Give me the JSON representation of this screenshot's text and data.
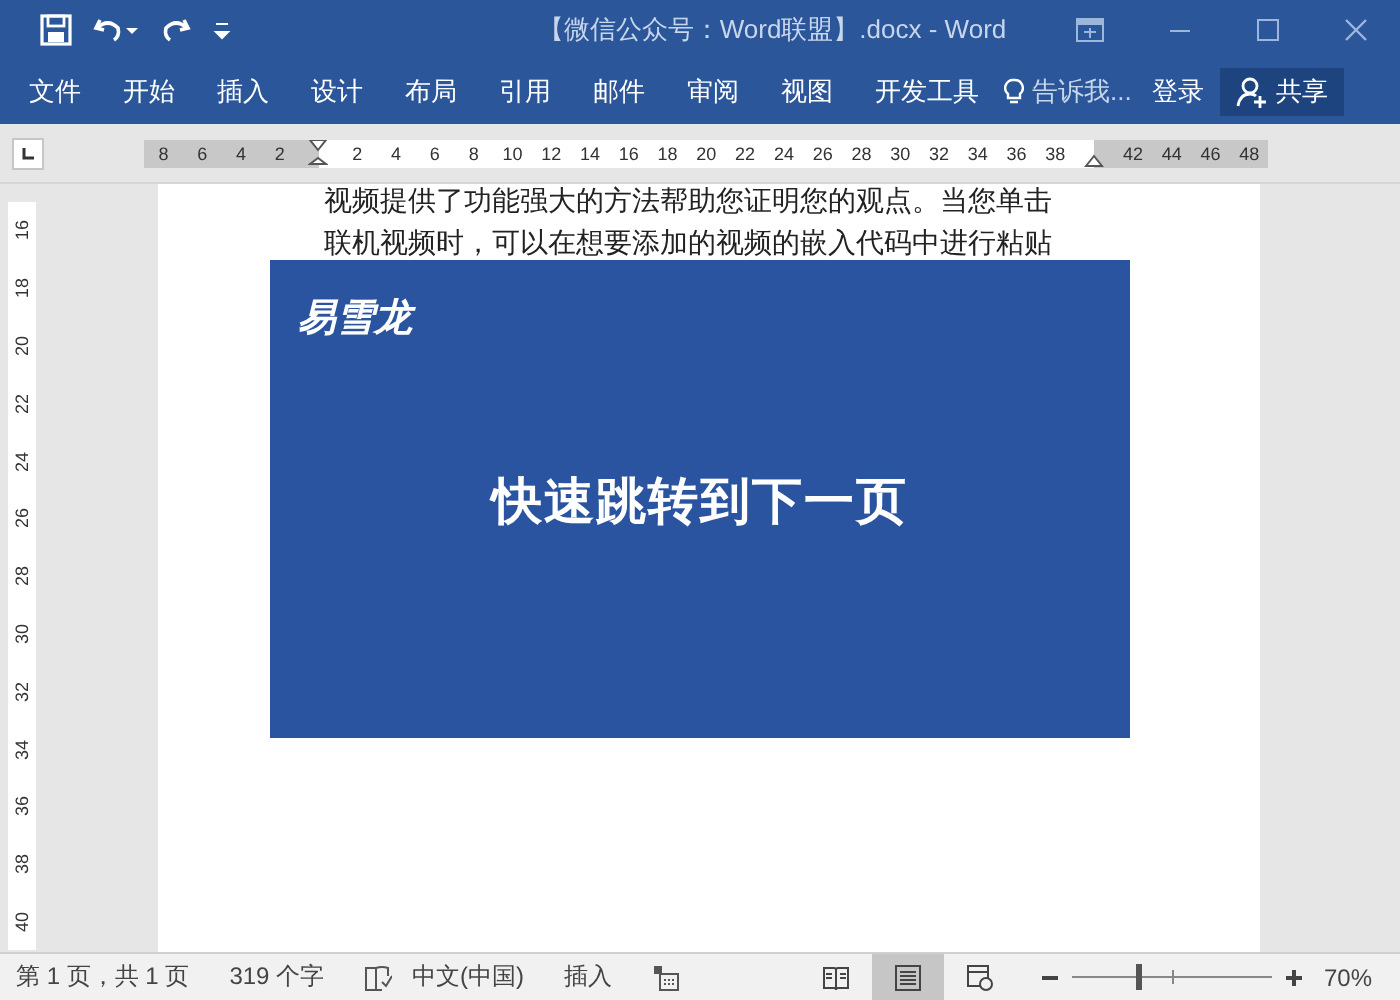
{
  "window": {
    "title": "【微信公众号：Word联盟】.docx - Word"
  },
  "ribbon": {
    "tabs": [
      {
        "label": "文件",
        "selected": false
      },
      {
        "label": "开始",
        "selected": false
      },
      {
        "label": "插入",
        "selected": false
      },
      {
        "label": "设计",
        "selected": false
      },
      {
        "label": "布局",
        "selected": false
      },
      {
        "label": "引用",
        "selected": false
      },
      {
        "label": "邮件",
        "selected": false
      },
      {
        "label": "审阅",
        "selected": false
      },
      {
        "label": "视图",
        "selected": false
      },
      {
        "label": "开发工具",
        "selected": false
      }
    ],
    "tell_me": "告诉我...",
    "sign_in": "登录",
    "share": "共享"
  },
  "horizontal_ruler": {
    "ticks": [
      {
        "label": "8",
        "shaded": true
      },
      {
        "label": "6",
        "shaded": true
      },
      {
        "label": "4",
        "shaded": true
      },
      {
        "label": "2",
        "shaded": true
      },
      {
        "label": "2",
        "shaded": false
      },
      {
        "label": "4",
        "shaded": false
      },
      {
        "label": "6",
        "shaded": false
      },
      {
        "label": "8",
        "shaded": false
      },
      {
        "label": "10",
        "shaded": false
      },
      {
        "label": "12",
        "shaded": false
      },
      {
        "label": "14",
        "shaded": false
      },
      {
        "label": "16",
        "shaded": false
      },
      {
        "label": "18",
        "shaded": false
      },
      {
        "label": "20",
        "shaded": false
      },
      {
        "label": "22",
        "shaded": false
      },
      {
        "label": "24",
        "shaded": false
      },
      {
        "label": "26",
        "shaded": false
      },
      {
        "label": "28",
        "shaded": false
      },
      {
        "label": "30",
        "shaded": false
      },
      {
        "label": "32",
        "shaded": false
      },
      {
        "label": "34",
        "shaded": false
      },
      {
        "label": "36",
        "shaded": false
      },
      {
        "label": "38",
        "shaded": false
      },
      {
        "label": "42",
        "shaded": true
      },
      {
        "label": "44",
        "shaded": true
      },
      {
        "label": "46",
        "shaded": true
      },
      {
        "label": "48",
        "shaded": true
      }
    ]
  },
  "vertical_ruler": {
    "ticks": [
      "16",
      "18",
      "20",
      "22",
      "24",
      "26",
      "28",
      "30",
      "32",
      "34",
      "36",
      "38",
      "40"
    ]
  },
  "document": {
    "lines": [
      "视频提供了功能强大的方法帮助您证明您的观点。当您单击",
      "联机视频时，可以在想要添加的视频的嵌入代码中进行粘贴"
    ]
  },
  "banner": {
    "logo": "易雪龙",
    "heading": "快速跳转到下一页"
  },
  "status_bar": {
    "page": "第 1 页，共 1 页",
    "words": "319 个字",
    "language": "中文(中国)",
    "mode": "插入",
    "views": [
      {
        "kind": "read",
        "selected": false
      },
      {
        "kind": "print",
        "selected": true
      },
      {
        "kind": "web",
        "selected": false
      }
    ],
    "zoom": {
      "level": 0.33,
      "reading": "70%"
    }
  }
}
